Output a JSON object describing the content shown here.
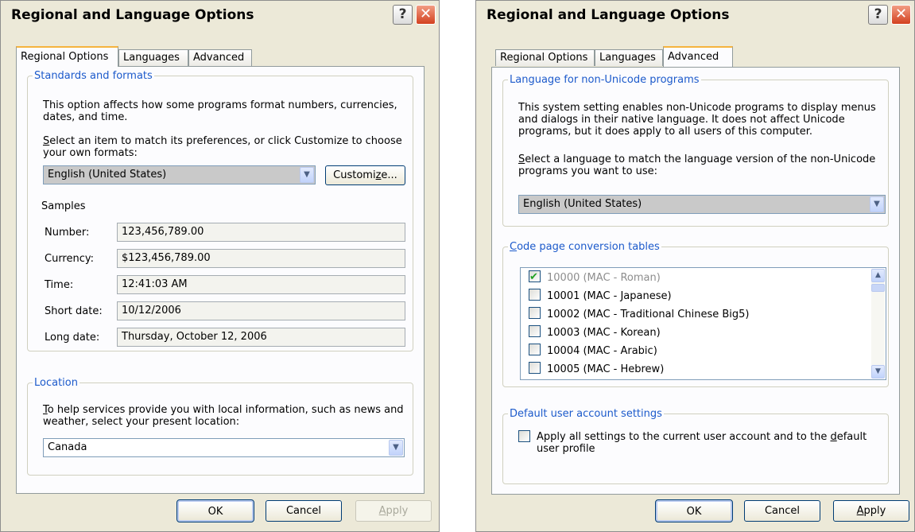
{
  "left": {
    "title": "Regional and Language Options",
    "tabs": [
      "Regional Options",
      "Languages",
      "Advanced"
    ],
    "standards": {
      "legend": "Standards and formats",
      "desc1": "This option affects how some programs format numbers, currencies,",
      "desc2": "dates, and time.",
      "select1": "Select an item to match its preferences, or click Customize to choose",
      "select2": "your own formats:",
      "format_value": "English (United States)",
      "customize": "Customize...",
      "samples_label": "Samples",
      "samples": [
        {
          "label": "Number:",
          "value": "123,456,789.00"
        },
        {
          "label": "Currency:",
          "value": "$123,456,789.00"
        },
        {
          "label": "Time:",
          "value": "12:41:03 AM"
        },
        {
          "label": "Short date:",
          "value": "10/12/2006"
        },
        {
          "label": "Long date:",
          "value": "Thursday, October 12, 2006"
        }
      ]
    },
    "location": {
      "legend": "Location",
      "desc1": "To help services provide you with local information, such as news and",
      "desc2": "weather, select your present location:",
      "value": "Canada"
    },
    "buttons": {
      "ok": "OK",
      "cancel": "Cancel",
      "apply": "Apply"
    }
  },
  "right": {
    "title": "Regional and Language Options",
    "tabs": [
      "Regional Options",
      "Languages",
      "Advanced"
    ],
    "nonunicode": {
      "legend": "Language for non-Unicode programs",
      "desc1": "This system setting enables non-Unicode programs to display menus",
      "desc2": "and dialogs in their native language. It does not affect Unicode",
      "desc3": "programs, but it does apply to all users of this computer.",
      "select1": "Select a language to match the language version of the non-Unicode",
      "select2": "programs you want to use:",
      "value": "English (United States)"
    },
    "codepage": {
      "legend": "Code page conversion tables",
      "items": [
        {
          "label": "10000 (MAC - Roman)",
          "checked": true
        },
        {
          "label": "10001 (MAC - Japanese)",
          "checked": false
        },
        {
          "label": "10002 (MAC - Traditional Chinese Big5)",
          "checked": false
        },
        {
          "label": "10003 (MAC - Korean)",
          "checked": false
        },
        {
          "label": "10004 (MAC - Arabic)",
          "checked": false
        },
        {
          "label": "10005 (MAC - Hebrew)",
          "checked": false
        }
      ]
    },
    "account": {
      "legend": "Default user account settings",
      "line1": "Apply all settings to the current user account and to the default",
      "line2": "user profile",
      "checked": false
    },
    "buttons": {
      "ok": "OK",
      "cancel": "Cancel",
      "apply": "Apply"
    }
  },
  "icons": {
    "help": "help-icon",
    "close": "close-icon",
    "dropdown": "chevron-down-icon",
    "scroll_up": "scroll-up-icon",
    "scroll_down": "scroll-down-icon"
  },
  "colors": {
    "dialog_bg": "#ece9d8",
    "group_legend": "#1c5acb",
    "close_button": "#d3411f",
    "active_tab_accent": "#f5b33e"
  }
}
